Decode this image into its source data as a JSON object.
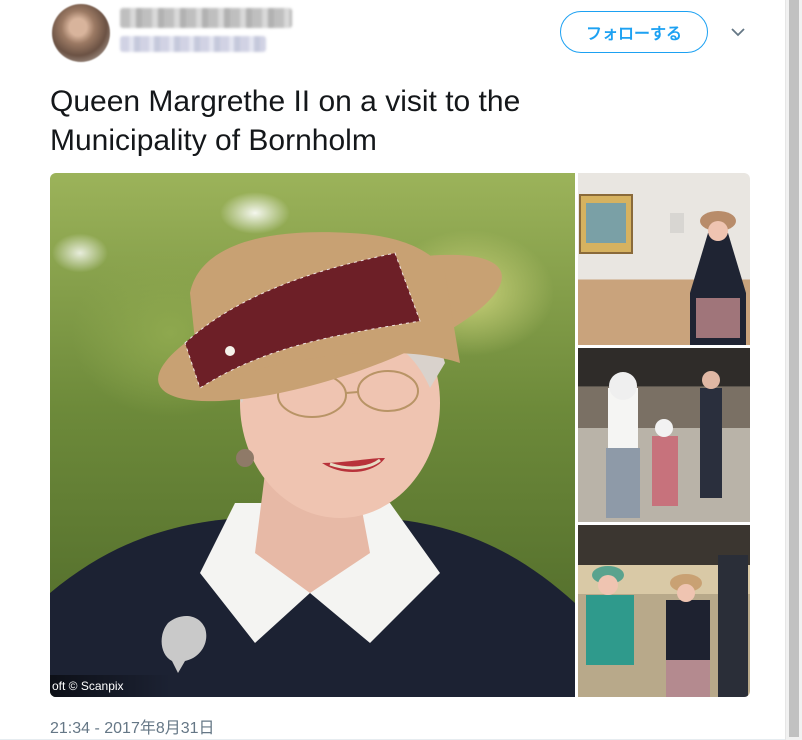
{
  "header": {
    "follow_label": "フォローする",
    "caret_icon": "chevron-down-icon"
  },
  "tweet": {
    "text_line1": "Queen Margrethe II on a visit to the",
    "text_line2": "Municipality of Bornholm",
    "timestamp": "21:34 - 2017年8月31日"
  },
  "media": {
    "main_photo_credit": "oft © Scanpix"
  },
  "colors": {
    "accent": "#1da1f2",
    "text": "#14171a",
    "muted": "#657786"
  }
}
